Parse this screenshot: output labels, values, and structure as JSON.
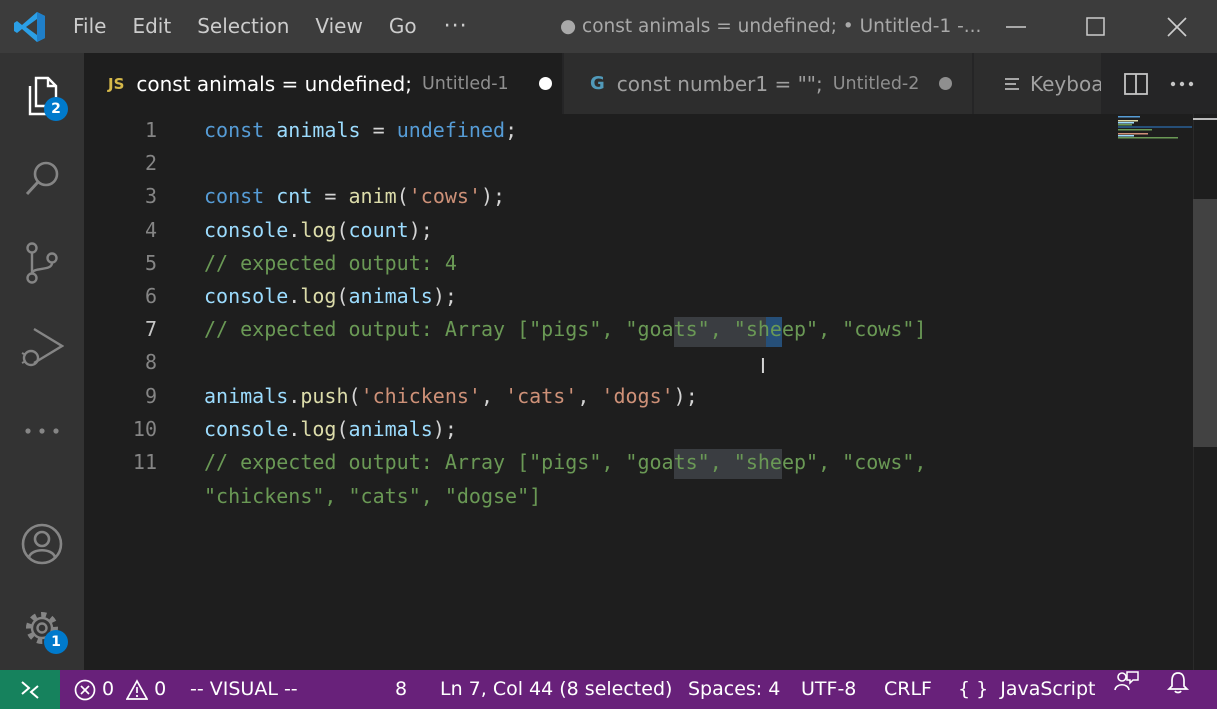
{
  "menu": [
    "File",
    "Edit",
    "Selection",
    "View",
    "Go"
  ],
  "window_title": "● const animals = undefined; • Untitled-1 -...",
  "activity_badges": {
    "explorer": "2",
    "settings": "1"
  },
  "tabs": [
    {
      "icon": "JS",
      "title": "const animals = undefined;",
      "desc": "Untitled-1"
    },
    {
      "title": "const number1 = \"\";",
      "desc": "Untitled-2"
    },
    {
      "title": "Keyboa"
    }
  ],
  "line_numbers": [
    "1",
    "2",
    "3",
    "4",
    "5",
    "6",
    "7",
    "8",
    "9",
    "10",
    "11"
  ],
  "status": {
    "errors": "0",
    "warnings": "0",
    "mode": "-- VISUAL --",
    "count": "8",
    "position": "Ln 7, Col 44 (8 selected)",
    "spaces": "Spaces: 4",
    "encoding": "UTF-8",
    "eol": "CRLF",
    "language_icon": "{ }",
    "language": "JavaScript"
  },
  "colors": {
    "statusbar": "#68217a",
    "remote": "#16825d",
    "accent": "#007acc",
    "keyword": "#569cd6",
    "variable": "#9cdcfe",
    "function": "#dcdcaa",
    "string": "#ce9178",
    "comment": "#6a9955"
  }
}
